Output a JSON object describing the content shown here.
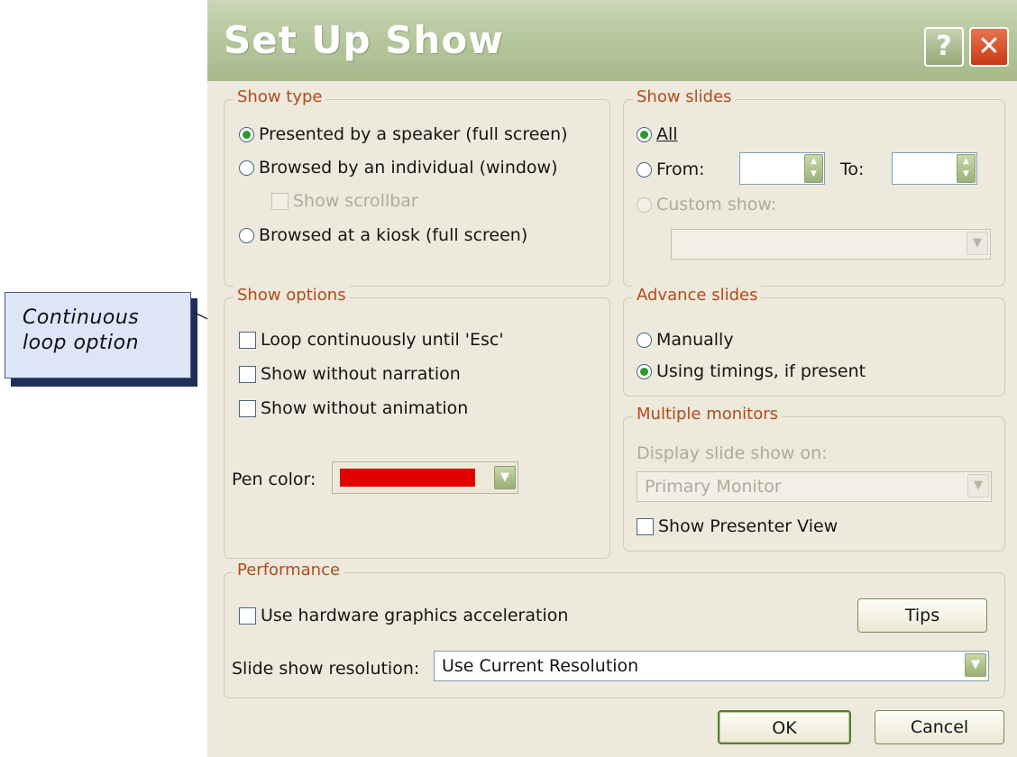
{
  "callout": {
    "line1": "Continuous",
    "line2": "loop option"
  },
  "dialog": {
    "title": "Set Up Show",
    "help_label": "?",
    "close_label": "✕",
    "show_type": {
      "legend": "Show type",
      "options": [
        {
          "label": "Presented by a speaker (full screen)",
          "checked": true
        },
        {
          "label": "Browsed by an individual (window)",
          "checked": false
        },
        {
          "label": "Browsed at a kiosk (full screen)",
          "checked": false
        }
      ],
      "show_scrollbar": "Show scrollbar"
    },
    "show_slides": {
      "legend": "Show slides",
      "all": "All",
      "from": "From:",
      "to": "To:",
      "custom_show": "Custom show:"
    },
    "show_options": {
      "legend": "Show options",
      "loop": "Loop continuously until 'Esc'",
      "no_narration": "Show without narration",
      "no_animation": "Show without animation",
      "pen_color_label": "Pen color:",
      "pen_color": "#e00000"
    },
    "advance_slides": {
      "legend": "Advance slides",
      "manually": "Manually",
      "timings": "Using timings, if present"
    },
    "multiple_monitors": {
      "legend": "Multiple monitors",
      "display_on": "Display slide show on:",
      "monitor_value": "Primary Monitor",
      "presenter_view": "Show Presenter View"
    },
    "performance": {
      "legend": "Performance",
      "hw_accel": "Use hardware graphics acceleration",
      "tips": "Tips",
      "resolution_label": "Slide show resolution:",
      "resolution_value": "Use Current Resolution"
    },
    "ok": "OK",
    "cancel": "Cancel"
  }
}
